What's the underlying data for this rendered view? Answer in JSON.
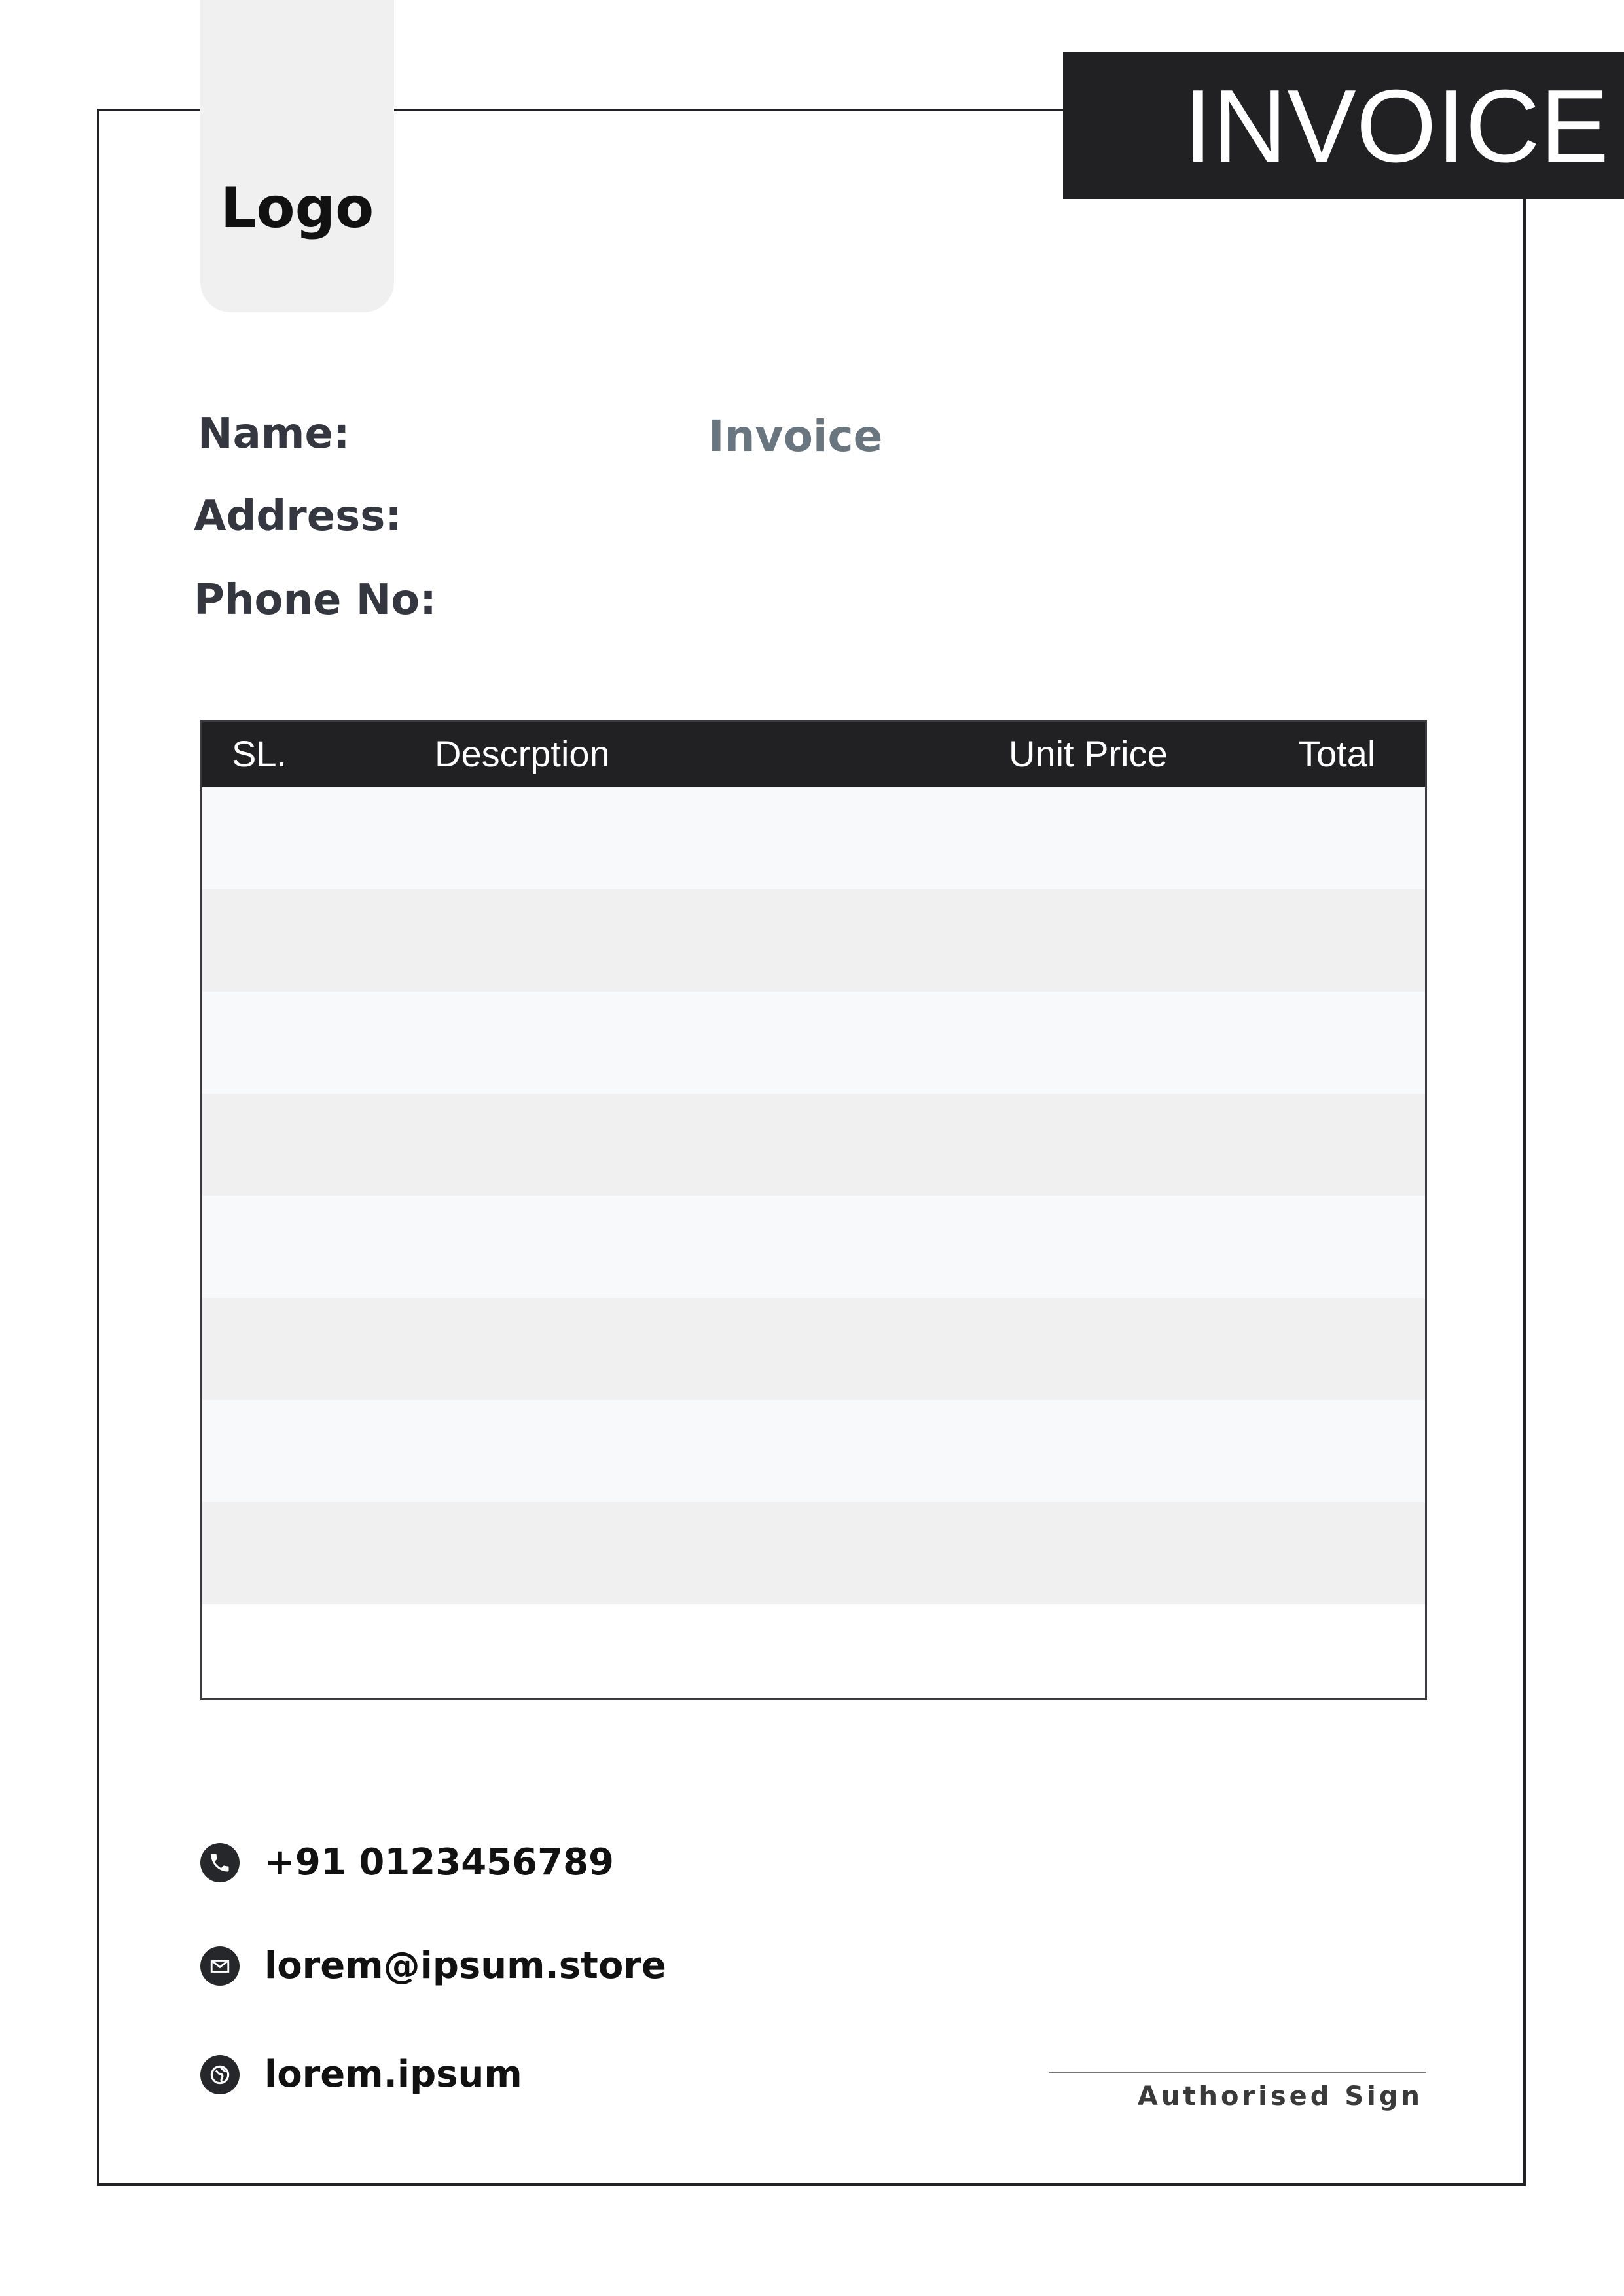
{
  "header": {
    "logo_text": "Logo",
    "title": "INVOICE"
  },
  "customer": {
    "name_label": "Name:",
    "address_label": "Address:",
    "phone_label": "Phone No:",
    "document_label": "Invoice"
  },
  "table": {
    "columns": [
      "SL.",
      "Descrption",
      "Unit Price",
      "Total"
    ],
    "rows": [
      [
        "",
        "",
        "",
        ""
      ],
      [
        "",
        "",
        "",
        ""
      ],
      [
        "",
        "",
        "",
        ""
      ],
      [
        "",
        "",
        "",
        ""
      ],
      [
        "",
        "",
        "",
        ""
      ],
      [
        "",
        "",
        "",
        ""
      ],
      [
        "",
        "",
        "",
        ""
      ],
      [
        "",
        "",
        "",
        ""
      ],
      [
        "",
        "",
        "",
        ""
      ]
    ]
  },
  "contact": {
    "phone": "+91 0123456789",
    "phone_icon": "phone-icon",
    "email": "lorem@ipsum.store",
    "email_icon": "mail-icon",
    "website": "lorem.ipsum",
    "website_icon": "globe-icon"
  },
  "signature": {
    "label": "Authorised Sign"
  },
  "colors": {
    "dark": "#212124",
    "row_light": "#f8f9fa",
    "row_shade": "#eff0ef",
    "accent_gray": "#6a767f"
  }
}
